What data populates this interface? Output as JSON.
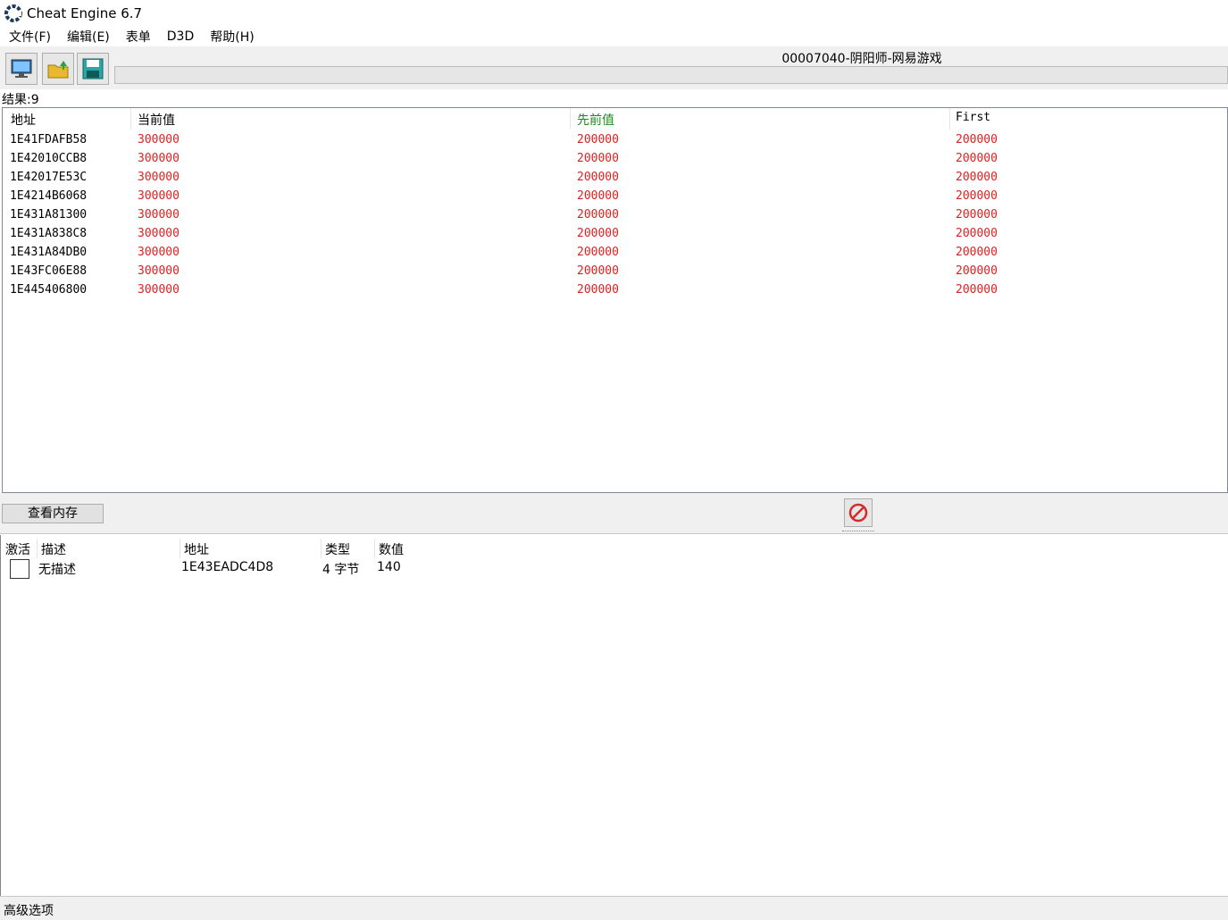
{
  "window": {
    "title": "Cheat Engine 6.7"
  },
  "menu": [
    "文件(F)",
    "编辑(E)",
    "表单",
    "D3D",
    "帮助(H)"
  ],
  "toolbar": {
    "process_name": "00007040-阴阳师-网易游戏",
    "buttons": [
      "open-process",
      "open-file",
      "save-file"
    ]
  },
  "results": {
    "label": "结果:9"
  },
  "scan_list": {
    "columns": [
      "地址",
      "当前值",
      "先前值",
      "First"
    ],
    "rows": [
      {
        "address": "1E41FDAFB58",
        "current": "300000",
        "previous": "200000",
        "first": "200000"
      },
      {
        "address": "1E42010CCB8",
        "current": "300000",
        "previous": "200000",
        "first": "200000"
      },
      {
        "address": "1E42017E53C",
        "current": "300000",
        "previous": "200000",
        "first": "200000"
      },
      {
        "address": "1E4214B6068",
        "current": "300000",
        "previous": "200000",
        "first": "200000"
      },
      {
        "address": "1E431A81300",
        "current": "300000",
        "previous": "200000",
        "first": "200000"
      },
      {
        "address": "1E431A838C8",
        "current": "300000",
        "previous": "200000",
        "first": "200000"
      },
      {
        "address": "1E431A84DB0",
        "current": "300000",
        "previous": "200000",
        "first": "200000"
      },
      {
        "address": "1E43FC06E88",
        "current": "300000",
        "previous": "200000",
        "first": "200000"
      },
      {
        "address": "1E445406800",
        "current": "300000",
        "previous": "200000",
        "first": "200000"
      }
    ]
  },
  "middle": {
    "view_memory_label": "查看内存"
  },
  "address_list": {
    "columns": [
      "激活",
      "描述",
      "地址",
      "类型",
      "数值"
    ],
    "rows": [
      {
        "active": false,
        "description": "无描述",
        "address": "1E43EADC4D8",
        "type": "4 字节",
        "value": "140"
      }
    ]
  },
  "status": {
    "advanced_label": "高级选项"
  },
  "colors": {
    "value_red": "#e02020",
    "previous_header_green": "#1a8a1a"
  }
}
